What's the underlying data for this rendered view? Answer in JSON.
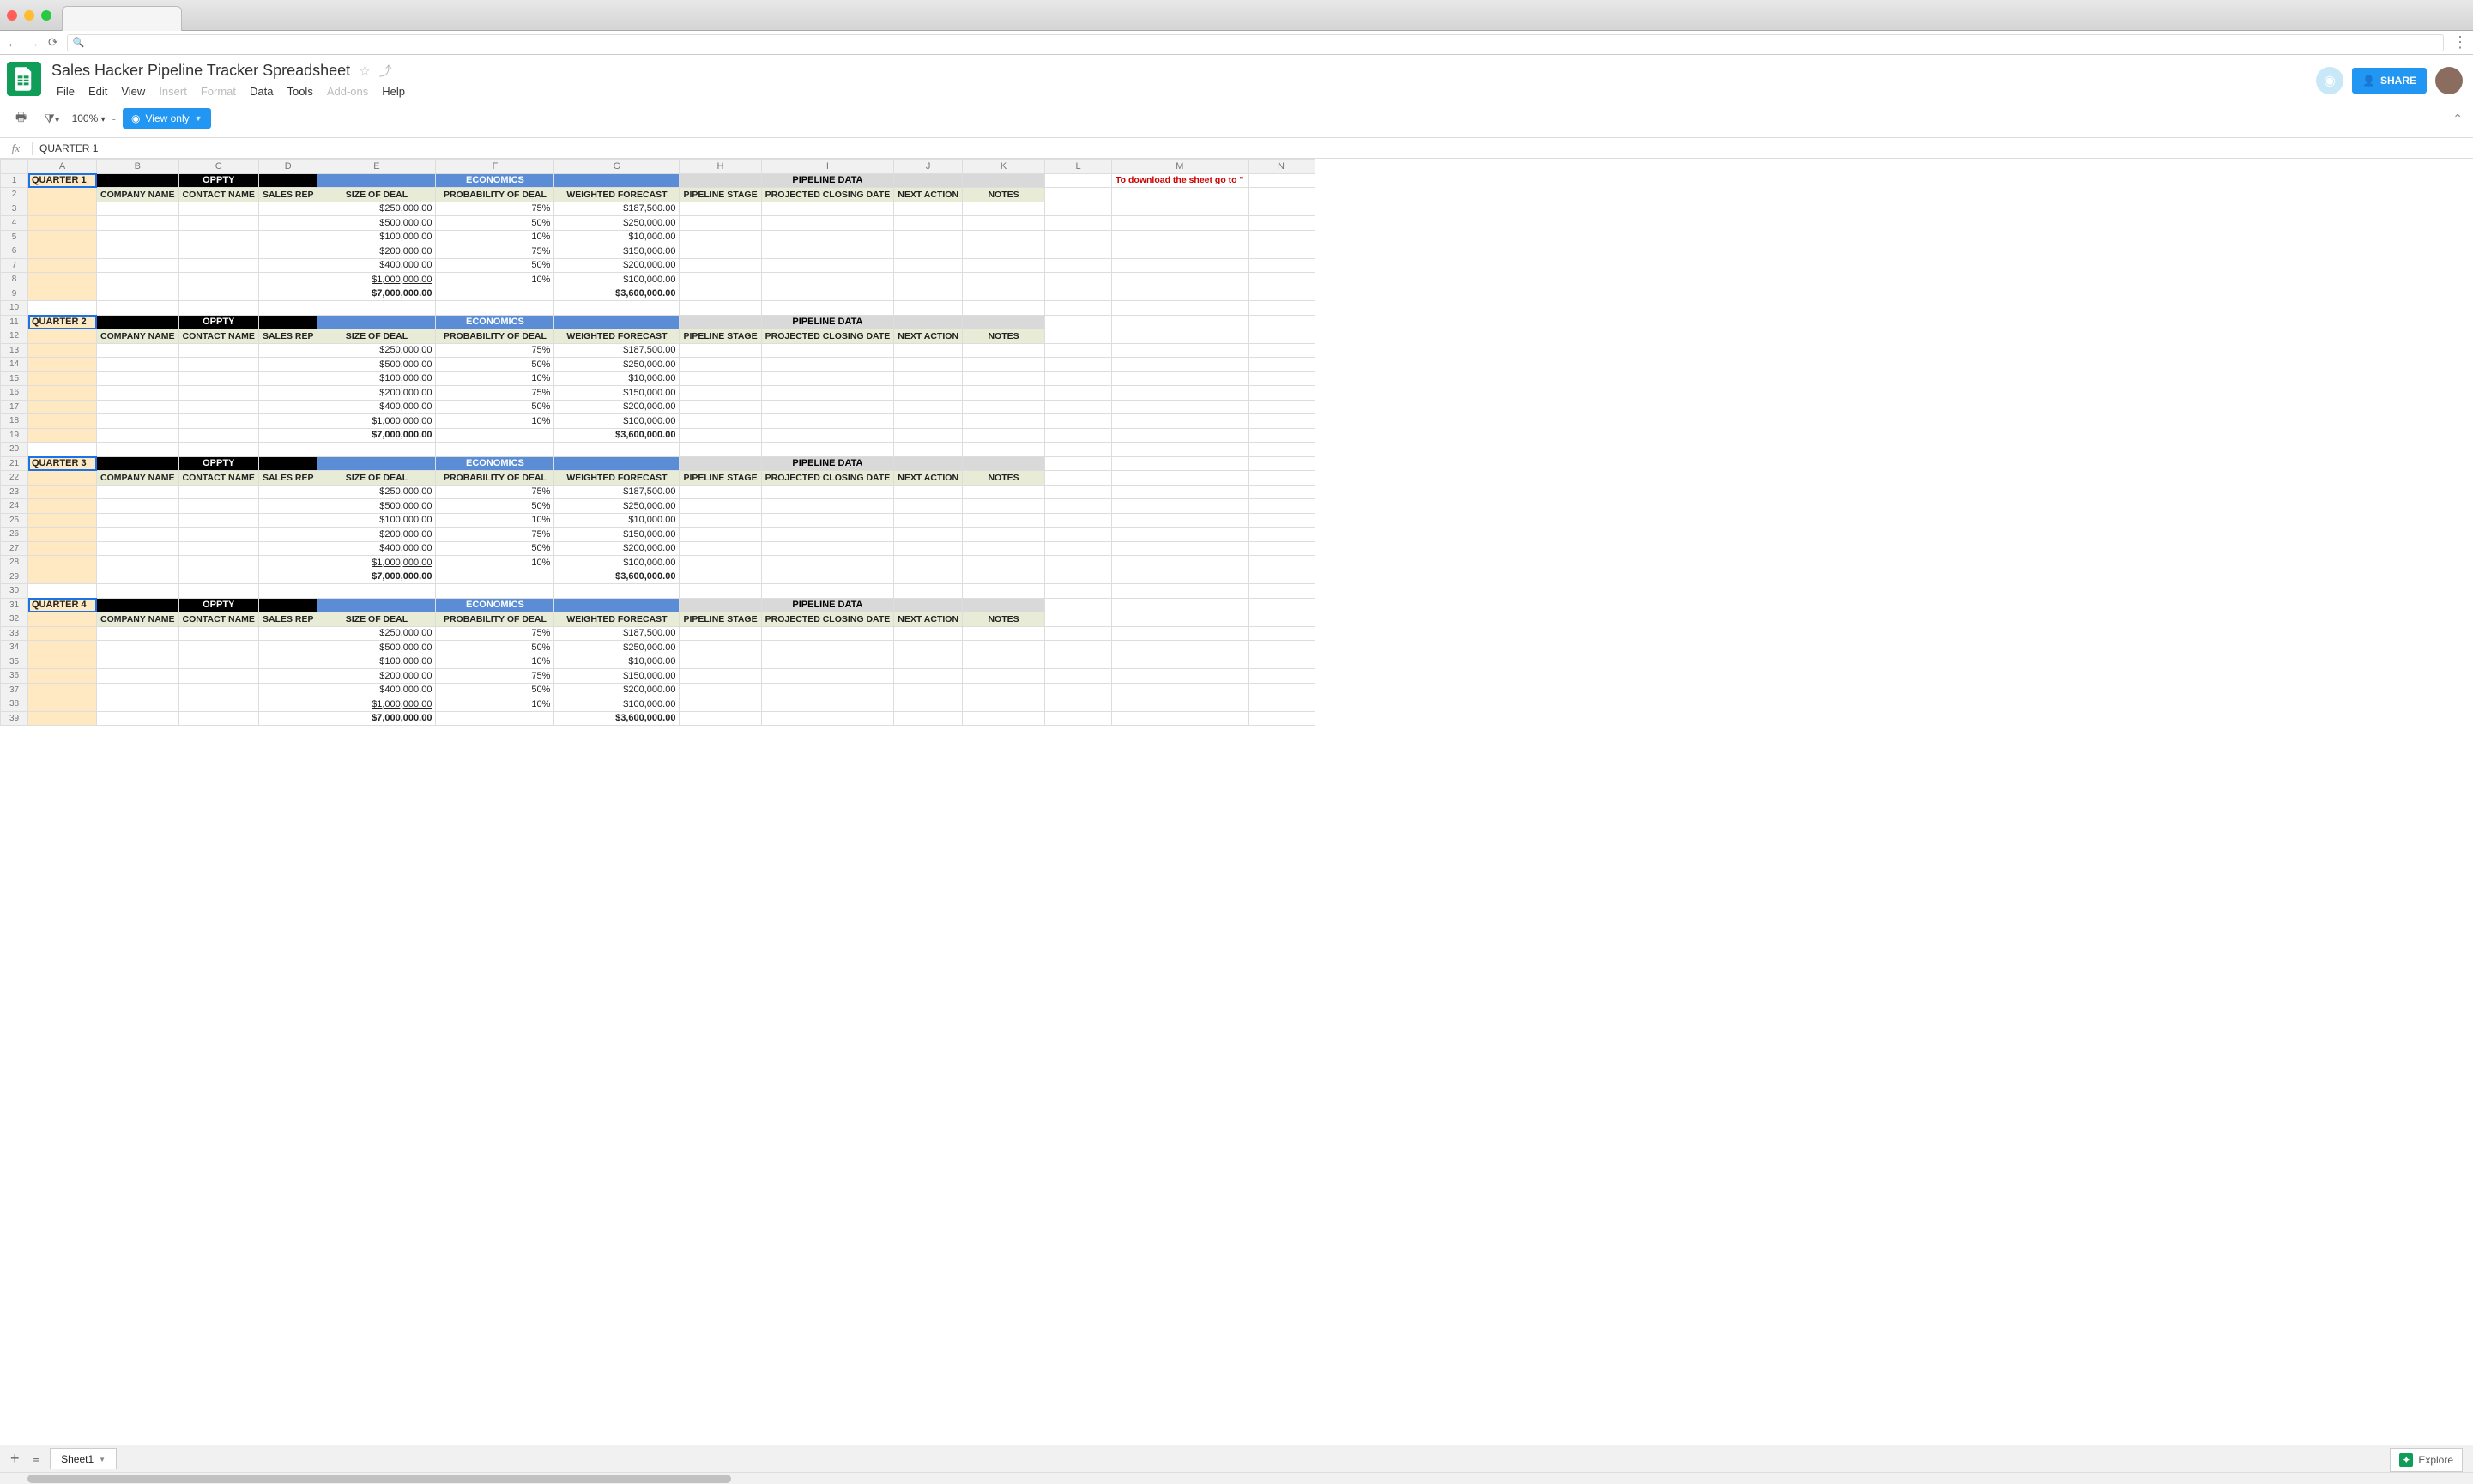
{
  "doc_title": "Sales Hacker Pipeline Tracker Spreadsheet",
  "menus": {
    "file": "File",
    "edit": "Edit",
    "view": "View",
    "insert": "Insert",
    "format": "Format",
    "data": "Data",
    "tools": "Tools",
    "addons": "Add-ons",
    "help": "Help"
  },
  "toolbar": {
    "zoom": "100%",
    "view_only": "View only"
  },
  "share_label": "SHARE",
  "fx_value": "QUARTER 1",
  "cols": [
    "A",
    "B",
    "C",
    "D",
    "E",
    "F",
    "G",
    "H",
    "I",
    "J",
    "K",
    "L",
    "M",
    "N"
  ],
  "row_count": 39,
  "note_text": "To download the sheet go to \"",
  "section_hdrs": {
    "oppty": "OPPTY",
    "econ": "ECONOMICS",
    "pipe": "PIPELINE DATA"
  },
  "sub_hdrs": {
    "company": "COMPANY NAME",
    "contact": "CONTACT NAME",
    "rep": "SALES REP",
    "size": "SIZE OF DEAL",
    "prob": "PROBABILITY OF DEAL",
    "forecast": "WEIGHTED FORECAST",
    "stage": "PIPELINE STAGE",
    "close": "PROJECTED CLOSING DATE",
    "next": "NEXT ACTION",
    "notes": "NOTES"
  },
  "quarters": [
    {
      "row": 1,
      "label": "QUARTER 1"
    },
    {
      "row": 11,
      "label": "QUARTER 2"
    },
    {
      "row": 21,
      "label": "QUARTER 3"
    },
    {
      "row": 31,
      "label": "QUARTER 4"
    }
  ],
  "deals": [
    {
      "size": "$250,000.00",
      "prob": "75%",
      "forecast": "$187,500.00"
    },
    {
      "size": "$500,000.00",
      "prob": "50%",
      "forecast": "$250,000.00"
    },
    {
      "size": "$100,000.00",
      "prob": "10%",
      "forecast": "$10,000.00"
    },
    {
      "size": "$200,000.00",
      "prob": "75%",
      "forecast": "$150,000.00"
    },
    {
      "size": "$400,000.00",
      "prob": "50%",
      "forecast": "$200,000.00"
    },
    {
      "size": "$1,000,000.00",
      "prob": "10%",
      "forecast": "$100,000.00"
    }
  ],
  "totals": {
    "size": "$7,000,000.00",
    "forecast": "$3,600,000.00"
  },
  "sheet_tab": "Sheet1",
  "explore": "Explore"
}
